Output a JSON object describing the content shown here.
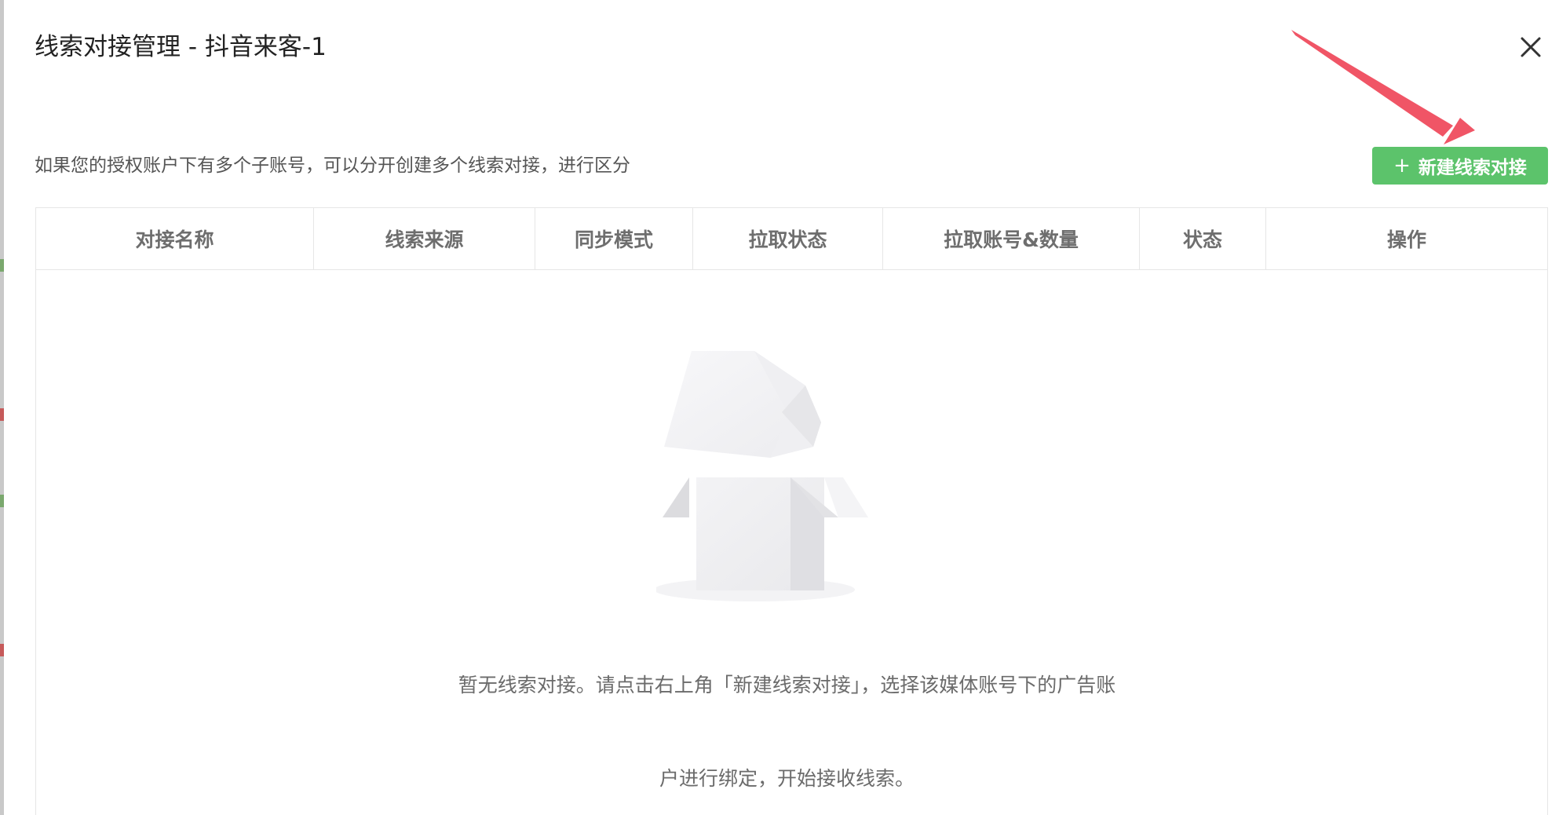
{
  "modal": {
    "title": "线索对接管理 - 抖音来客-1",
    "close_icon": "close-icon"
  },
  "toolbar": {
    "hint": "如果您的授权账户下有多个子账号，可以分开创建多个线索对接，进行区分",
    "new_button_icon": "plus-icon",
    "new_button_plus": "+",
    "new_button_label": "新建线索对接",
    "new_button_color": "#5cc36b"
  },
  "annotation": {
    "arrow_color": "#f05566",
    "arrow_icon": "pointer-arrow-icon"
  },
  "table": {
    "columns": [
      "对接名称",
      "线索来源",
      "同步模式",
      "拉取状态",
      "拉取账号&数量",
      "状态",
      "操作"
    ],
    "rows": []
  },
  "empty": {
    "illustration_icon": "empty-box-icon",
    "line1": "暂无线索对接。请点击右上角「新建线索对接」，选择该媒体账号下的广告账",
    "line2": "户进行绑定，开始接收线索。"
  }
}
